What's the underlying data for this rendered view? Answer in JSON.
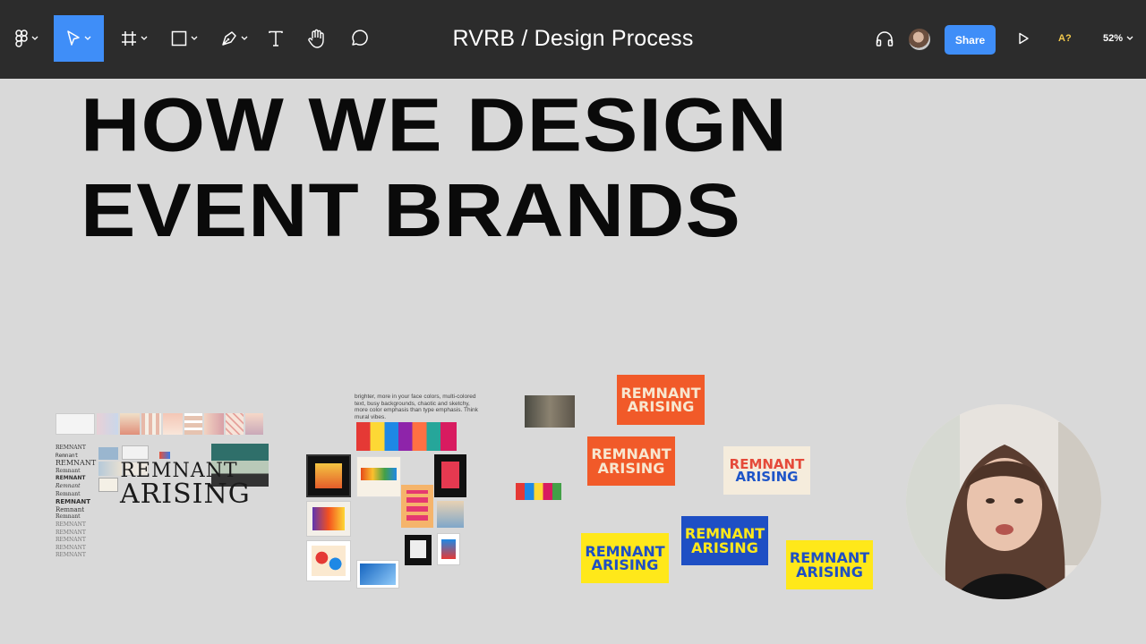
{
  "app": {
    "doc_title": "RVRB / Design Process",
    "share_label": "Share",
    "a11y_label": "A?",
    "zoom_label": "52%"
  },
  "colors": {
    "toolbar_bg": "#2c2c2c",
    "accent": "#3f8ef8",
    "canvas_bg": "#d9d9d9"
  },
  "icons": [
    "figma-menu-icon",
    "move-tool-icon",
    "frame-tool-icon",
    "shape-tool-icon",
    "pen-tool-icon",
    "text-tool-icon",
    "hand-tool-icon",
    "comment-tool-icon",
    "audio-icon",
    "play-icon",
    "chevron-down-icon"
  ],
  "canvas": {
    "headline_line1": "HOW WE DESIGN",
    "headline_line2": "EVENT BRANDS",
    "mood_note": "brighter, more in your face colors, multi-colored text, busy backgrounds, chaotic and sketchy, more color emphasis than type emphasis. Think mural vibes.",
    "logo_line1": "REMNANT",
    "logo_line2": "ARISING",
    "type_samples": [
      "REMNANT",
      "Remnant",
      "REMNANT",
      "Remnant",
      "REMNANT",
      "Remnant",
      "Remnant",
      "REMNANT",
      "Remnant",
      "Remnant",
      "REMNANT",
      "REMNANT",
      "REMNANT",
      "REMNANT",
      "REMNANT"
    ],
    "card_word1": "REMNANT",
    "card_word2": "ARISING"
  }
}
